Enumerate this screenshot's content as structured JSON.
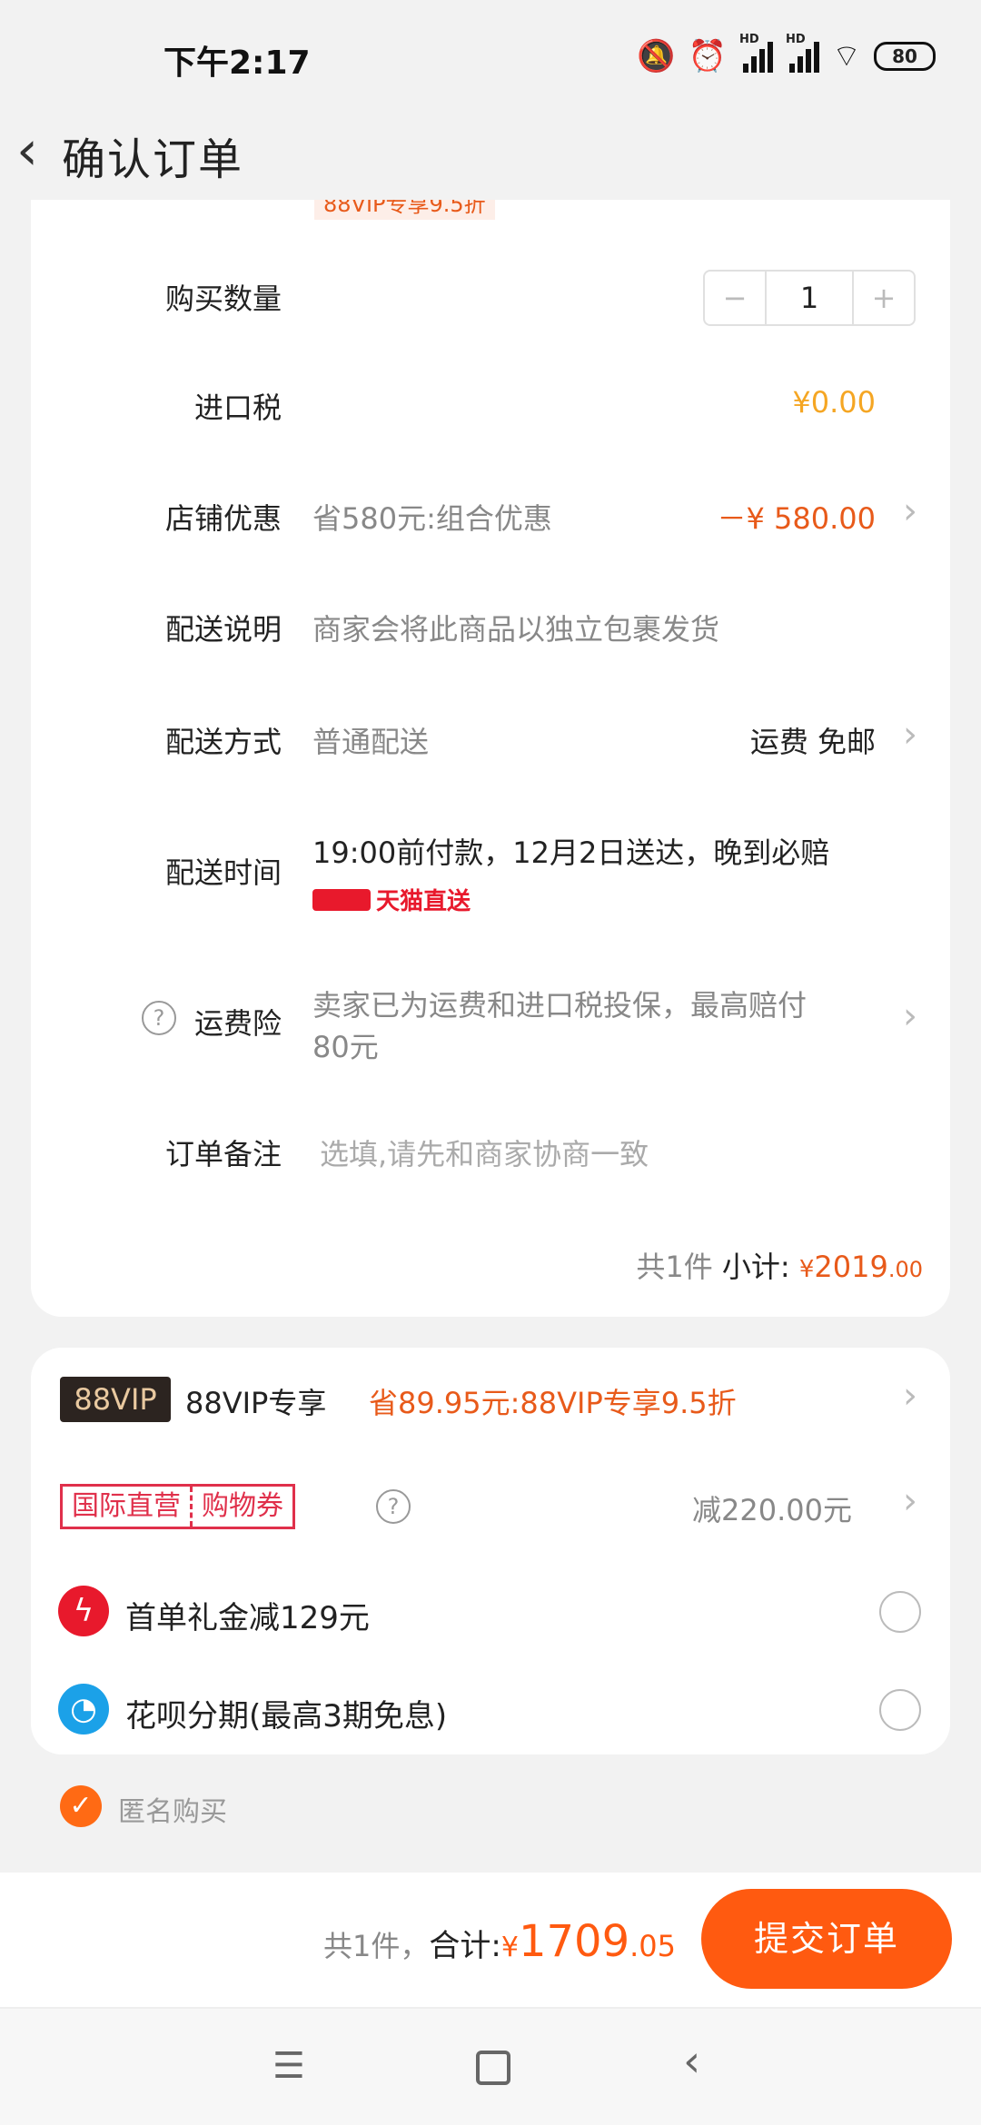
{
  "status_bar": {
    "time": "下午2:17",
    "battery": "80",
    "signal_label": "HD"
  },
  "header": {
    "title": "确认订单"
  },
  "promo_strip": "88VIP专享9.5折",
  "order": {
    "quantity": {
      "label": "购买数量",
      "minus": "−",
      "value": "1",
      "plus": "+"
    },
    "import_tax": {
      "label": "进口税",
      "value": "¥0.00"
    },
    "store_discount": {
      "label": "店铺优惠",
      "desc": "省580元:组合优惠",
      "amount": "－¥ 580.00"
    },
    "delivery_note": {
      "label": "配送说明",
      "value": "商家会将此商品以独立包裹发货"
    },
    "delivery_method": {
      "label": "配送方式",
      "value": "普通配送",
      "fee": "运费 免邮"
    },
    "delivery_time": {
      "label": "配送时间",
      "value": "19:00前付款，12月2日送达，晚到必赔",
      "badge": "天猫直送"
    },
    "shipping_insurance": {
      "label": "运费险",
      "line1": "卖家已为运费和进口税投保，最高赔付",
      "line2": "80元"
    },
    "remark": {
      "label": "订单备注",
      "placeholder": "选填,请先和商家协商一致"
    },
    "subtotal": {
      "count": "共1件",
      "label": "小计:",
      "currency": "¥",
      "integer": "2019",
      "decimal": ".00"
    }
  },
  "benefits": {
    "vip": {
      "badge": "88VIP",
      "label": "88VIP专享",
      "desc": "省89.95元:88VIP专享9.5折"
    },
    "coupon": {
      "badge_left": "国际直营",
      "badge_right": "购物券",
      "value": "减220.00元"
    },
    "first_order": {
      "label": "首单礼金减129元"
    },
    "huabei": {
      "label": "花呗分期(最高3期免息)"
    }
  },
  "anonymous": {
    "label": "匿名购买",
    "checked": true
  },
  "footer": {
    "count": "共1件，",
    "label": "合计:",
    "currency": "¥",
    "integer": "1709",
    "decimal": ".05",
    "submit": "提交订单"
  },
  "colors": {
    "accent": "#ff5a10",
    "price": "#e85a1a",
    "tax": "#f5a623",
    "tmall": "#e8192c"
  }
}
